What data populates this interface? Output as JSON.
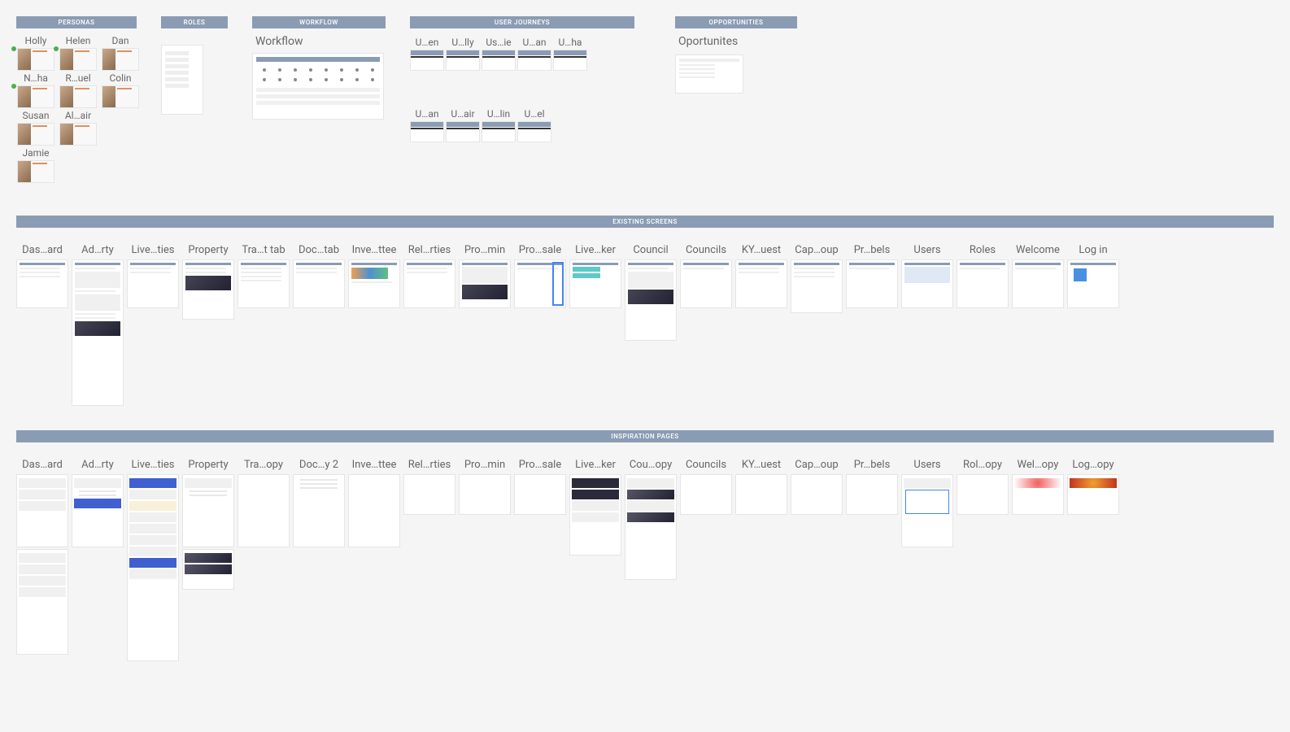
{
  "top_sections": {
    "personas": {
      "header": "Personas",
      "items": [
        {
          "name": "Holly",
          "online": true
        },
        {
          "name": "Helen",
          "online": true
        },
        {
          "name": "Dan",
          "online": false
        },
        {
          "name": "N…ha",
          "online": true
        },
        {
          "name": "R…uel",
          "online": false
        },
        {
          "name": "Colin",
          "online": false
        },
        {
          "name": "Susan",
          "online": false
        },
        {
          "name": "Al…air",
          "online": false
        },
        {
          "name": "",
          "online": false
        },
        {
          "name": "Jamie",
          "online": false
        }
      ]
    },
    "roles": {
      "header": "Roles"
    },
    "workflow": {
      "header": "Workflow",
      "title": "Workflow"
    },
    "user_journeys": {
      "header": "User Journeys",
      "row1": [
        "U…en",
        "U…lly",
        "Us…ie",
        "U…an",
        "U…ha"
      ],
      "row2": [
        "U…an",
        "U…air",
        "U…lin",
        "U…el"
      ]
    },
    "opportunities": {
      "header": "Opportunities",
      "title": "Oportunites"
    }
  },
  "existing_screens": {
    "header": "Existing Screens",
    "items": [
      "Das…ard",
      "Ad…rty",
      "Live…ties",
      "Property",
      "Tra…t tab",
      "Doc…tab",
      "Inve…ttee",
      "Rel…rties",
      "Pro…min",
      "Pro…sale",
      "Live…ker",
      "Council",
      "Councils",
      "KY…uest",
      "Cap…oup",
      "Pr…bels",
      "Users",
      "Roles",
      "Welcome",
      "Log in"
    ]
  },
  "inspiration": {
    "header": "Inspiration Pages",
    "items": [
      "Das…ard",
      "Ad…rty",
      "Live…ties",
      "Property",
      "Tra…opy",
      "Doc…y 2",
      "Inve…ttee",
      "Rel…rties",
      "Pro…min",
      "Pro…sale",
      "Live…ker",
      "Cou…opy",
      "Councils",
      "KY…uest",
      "Cap…oup",
      "Pr…bels",
      "Users",
      "Rol…opy",
      "Wel…opy",
      "Log…opy"
    ]
  }
}
